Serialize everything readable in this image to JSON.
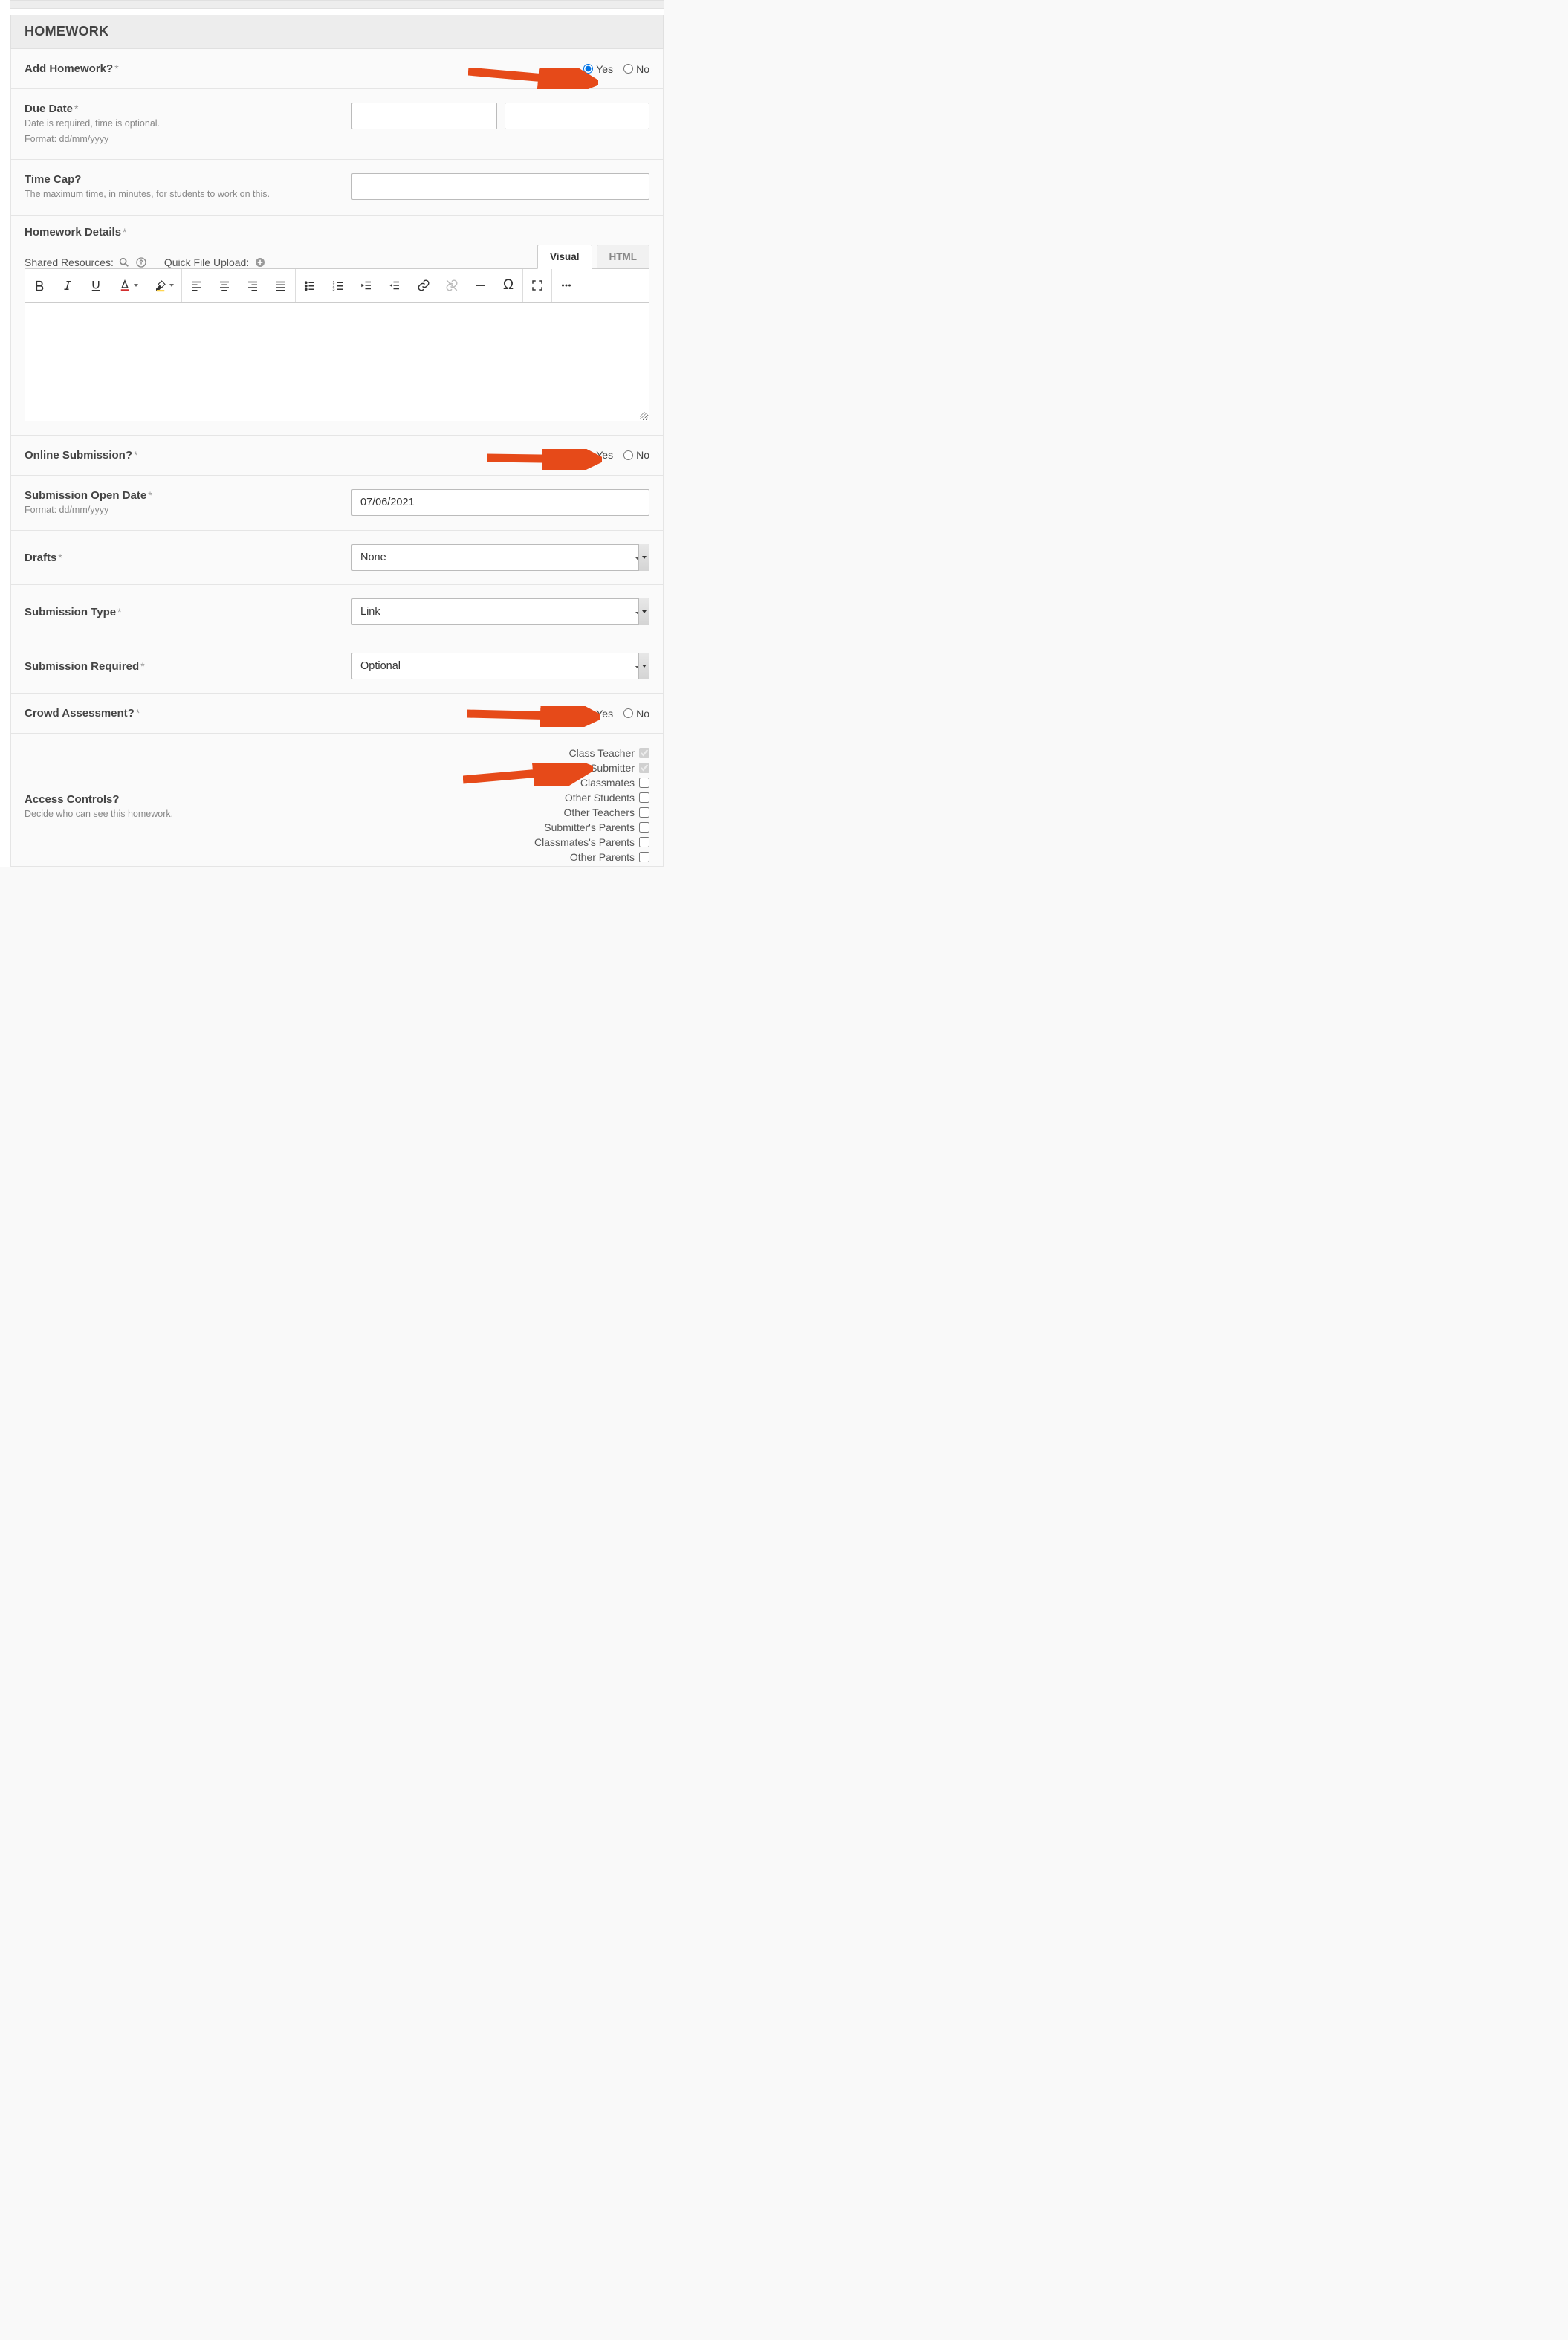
{
  "section": {
    "title": "HOMEWORK"
  },
  "addHomework": {
    "label": "Add Homework?",
    "yes": "Yes",
    "no": "No"
  },
  "dueDate": {
    "label": "Due Date",
    "help1": "Date is required, time is optional.",
    "help2": "Format: dd/mm/yyyy"
  },
  "timeCap": {
    "label": "Time Cap?",
    "help": "The maximum time, in minutes, for students to work on this."
  },
  "details": {
    "label": "Homework Details",
    "sharedResources": "Shared Resources:",
    "quickUpload": "Quick File Upload:",
    "tabVisual": "Visual",
    "tabHtml": "HTML"
  },
  "onlineSubmission": {
    "label": "Online Submission?",
    "yes": "Yes",
    "no": "No"
  },
  "submissionOpenDate": {
    "label": "Submission Open Date",
    "help": "Format: dd/mm/yyyy",
    "value": "07/06/2021"
  },
  "drafts": {
    "label": "Drafts",
    "selected": "None"
  },
  "submissionType": {
    "label": "Submission Type",
    "selected": "Link"
  },
  "submissionRequired": {
    "label": "Submission Required",
    "selected": "Optional"
  },
  "crowdAssessment": {
    "label": "Crowd Assessment?",
    "yes": "Yes",
    "no": "No"
  },
  "accessControls": {
    "label": "Access Controls?",
    "help": "Decide who can see this homework.",
    "items": [
      {
        "label": "Class Teacher",
        "checked": true,
        "disabled": true
      },
      {
        "label": "Submitter",
        "checked": true,
        "disabled": true
      },
      {
        "label": "Classmates",
        "checked": false,
        "disabled": false
      },
      {
        "label": "Other Students",
        "checked": false,
        "disabled": false
      },
      {
        "label": "Other Teachers",
        "checked": false,
        "disabled": false
      },
      {
        "label": "Submitter's Parents",
        "checked": false,
        "disabled": false
      },
      {
        "label": "Classmates's Parents",
        "checked": false,
        "disabled": false
      },
      {
        "label": "Other Parents",
        "checked": false,
        "disabled": false
      }
    ]
  }
}
